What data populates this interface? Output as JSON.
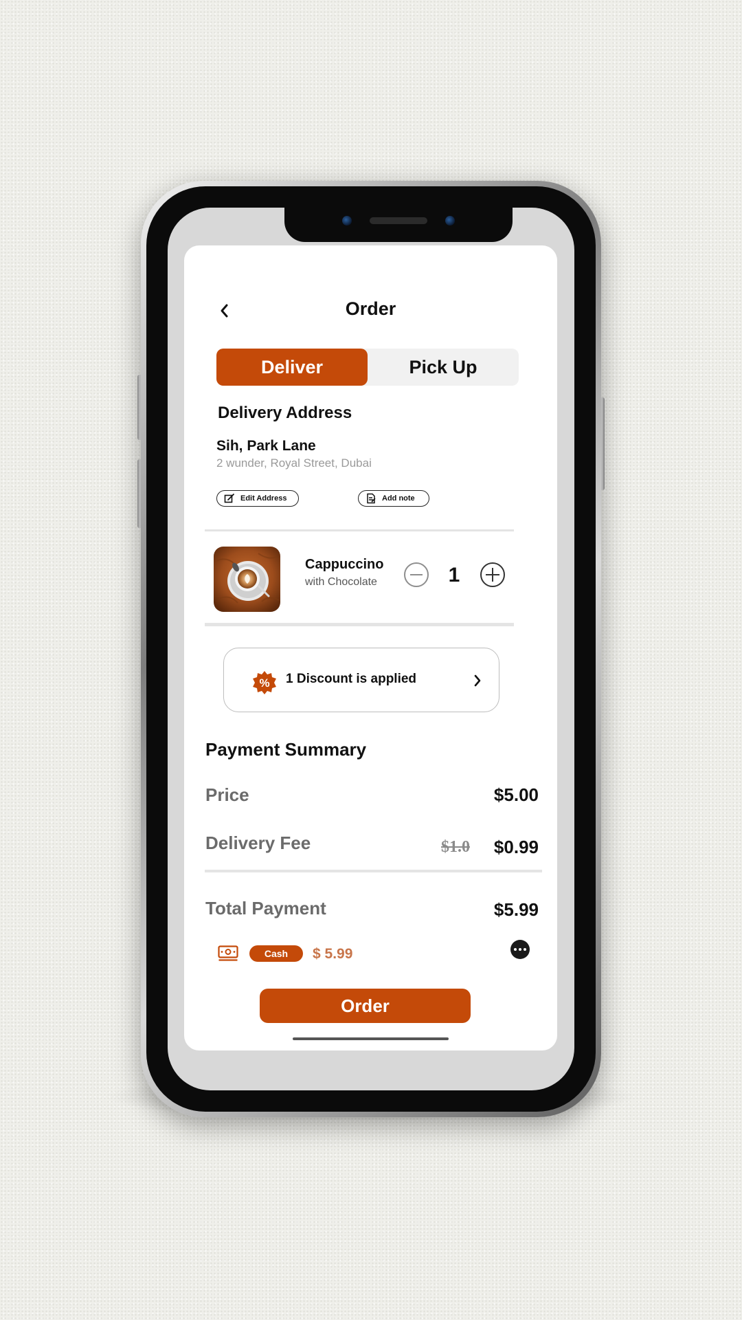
{
  "header": {
    "title": "Order",
    "back_icon": "chevron-left-icon"
  },
  "tabs": [
    {
      "label": "Deliver",
      "active": true
    },
    {
      "label": "Pick Up",
      "active": false
    }
  ],
  "delivery": {
    "heading": "Delivery Address",
    "name": "Sih, Park Lane",
    "address": "2 wunder, Royal Street, Dubai",
    "edit_label": "Edit Address",
    "note_label": "Add note"
  },
  "cart_item": {
    "name": "Cappuccino",
    "variant": "with Chocolate",
    "quantity": "1"
  },
  "discount": {
    "label": "1 Discount is applied",
    "icon": "%"
  },
  "payment_summary": {
    "heading": "Payment Summary",
    "price_label": "Price",
    "price_value": "$5.00",
    "fee_label": "Delivery Fee",
    "fee_original": "$1.0",
    "fee_value": "$0.99",
    "total_label": "Total Payment",
    "total_value": "$5.99"
  },
  "payment_method": {
    "label": "Cash",
    "amount": "$ 5.99"
  },
  "order_button": "Order",
  "colors": {
    "accent": "#c44a09",
    "muted_text": "#6b6b6b",
    "amount_text": "#c8754a"
  }
}
